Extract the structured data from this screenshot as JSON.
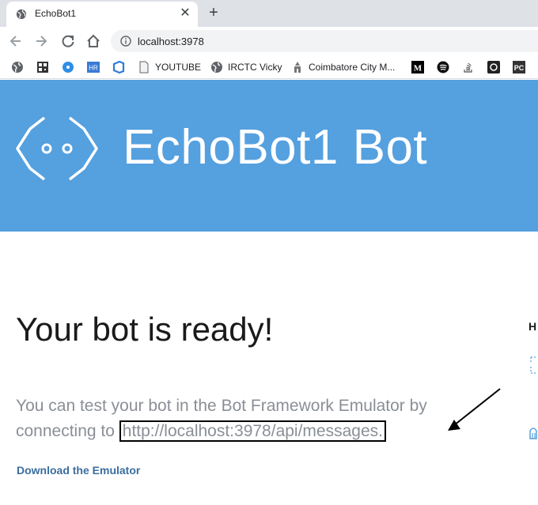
{
  "browser": {
    "tab_title": "EchoBot1",
    "address": "localhost:3978",
    "bookmarks": [
      {
        "label": "",
        "icon": "globe-icon"
      },
      {
        "label": "",
        "icon": "qr-icon"
      },
      {
        "label": "",
        "icon": "blue-circle-icon"
      },
      {
        "label": "HR",
        "icon": "hr-icon"
      },
      {
        "label": "",
        "icon": "azure-devops-icon"
      },
      {
        "label": "YOUTUBE",
        "icon": "page-icon"
      },
      {
        "label": "IRCTC Vicky",
        "icon": "globe-icon"
      },
      {
        "label": "Coimbatore City M...",
        "icon": "temple-icon"
      },
      {
        "label": "M",
        "icon": "medium-icon"
      },
      {
        "label": "",
        "icon": "spotify-icon"
      },
      {
        "label": "",
        "icon": "stackoverflow-icon"
      },
      {
        "label": "",
        "icon": "dark-square-icon"
      },
      {
        "label": "PC",
        "icon": "pc-icon"
      }
    ]
  },
  "banner": {
    "title": "EchoBot1 Bot",
    "color": "#55a0df"
  },
  "main": {
    "heading": "Your bot is ready!",
    "text_before": "You can test your bot in the Bot Framework Emulator by connecting to ",
    "endpoint": "http://localhost:3978/api/messages.",
    "download_link": "Download the Emulator",
    "side_heading": "H"
  }
}
